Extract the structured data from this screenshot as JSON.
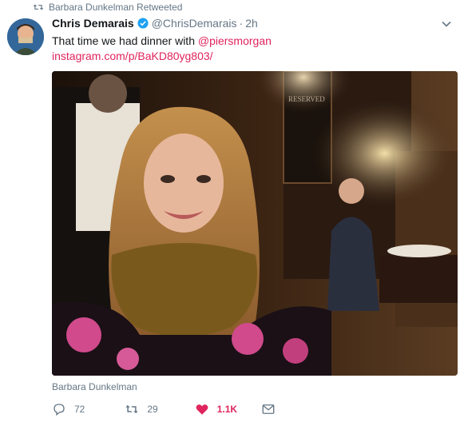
{
  "retweet_banner": {
    "text": "Barbara Dunkelman Retweeted",
    "icon": "retweet-icon"
  },
  "author": {
    "display_name": "Chris Demarais",
    "handle": "@ChrisDemarais",
    "time": "2h",
    "verified": true,
    "avatar_icon": "avatar"
  },
  "tweet": {
    "text_prefix": "That time we had dinner with ",
    "mention": "@piersmorgan",
    "link": "instagram.com/p/BaKD80yg803/"
  },
  "tagged": "Barbara Dunkelman",
  "actions": {
    "reply_count": "72",
    "retweet_count": "29",
    "like_count": "1.1K"
  },
  "colors": {
    "accent": "#e0245e",
    "muted": "#657786",
    "verified": "#1da1f2"
  }
}
